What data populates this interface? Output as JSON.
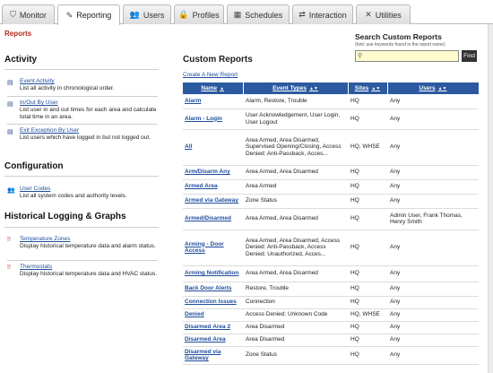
{
  "tabs": [
    {
      "label": "Monitor",
      "icon": "shield-icon"
    },
    {
      "label": "Reporting",
      "icon": "pencil-icon"
    },
    {
      "label": "Users",
      "icon": "users-icon"
    },
    {
      "label": "Profiles",
      "icon": "lock-icon"
    },
    {
      "label": "Schedules",
      "icon": "calendar-icon"
    },
    {
      "label": "Interaction",
      "icon": "arrows-icon"
    },
    {
      "label": "Utilities",
      "icon": "tools-icon"
    }
  ],
  "active_tab": "Reporting",
  "section_label": "Reports",
  "search": {
    "title": "Search Custom Reports",
    "hint": "(hint: use keywords found in the report name)",
    "value": "",
    "button": "Find"
  },
  "left": {
    "activity": {
      "heading": "Activity",
      "items": [
        {
          "link": "Event Activity",
          "desc": "List all activity in chronological order."
        },
        {
          "link": "In/Out By User",
          "desc": "List user in and out times for each area and calculate total time in an area."
        },
        {
          "link": "Exit Exception By User",
          "desc": "List users which have logged in but not logged out."
        }
      ]
    },
    "configuration": {
      "heading": "Configuration",
      "items": [
        {
          "link": "User Codes",
          "desc": "List all system codes and authority levels."
        }
      ]
    },
    "historical": {
      "heading": "Historical Logging & Graphs",
      "items": [
        {
          "link": "Temperature Zones",
          "desc": "Display historical temperature data and alarm status."
        },
        {
          "link": "Thermostats",
          "desc": "Display historical temperature data and HVAC status."
        }
      ]
    }
  },
  "custom_reports": {
    "title": "Custom Reports",
    "create_link": "Create A New Report",
    "columns": [
      "Name",
      "Event Types",
      "Sites",
      "Users"
    ],
    "rows": [
      {
        "name": "Alarm",
        "events": "Alarm, Restore, Trouble",
        "sites": "HQ",
        "users": "Any"
      },
      {
        "name": "Alarm - Login",
        "events": "User Acknowledgement, User Login, User Logout",
        "sites": "HQ",
        "users": "Any"
      },
      {
        "name": "All",
        "events": "Area Armed, Area Disarmed, Supervised Opening/Closing, Access Denied: Anti-Passback, Acces...",
        "sites": "HQ, WHSE",
        "users": "Any"
      },
      {
        "name": "Arm/Disarm Any",
        "events": "Area Armed, Area Disarmed",
        "sites": "HQ",
        "users": "Any"
      },
      {
        "name": "Armed Area",
        "events": "Area Armed",
        "sites": "HQ",
        "users": "Any"
      },
      {
        "name": "Armed via Gateway",
        "events": "Zone Status",
        "sites": "HQ",
        "users": "Any"
      },
      {
        "name": "Armed/Disarmed",
        "events": "Area Armed, Area Disarmed",
        "sites": "HQ",
        "users": "Admin User, Frank Thomas, Henry Smith"
      },
      {
        "name": "Arming - Door Access",
        "events": "Area Armed, Area Disarmed, Access Denied: Anti-Passback, Access Denied: Unauthorized, Acces...",
        "sites": "HQ",
        "users": "Any"
      },
      {
        "name": "Arming Notification",
        "events": "Area Armed, Area Disarmed",
        "sites": "HQ",
        "users": "Any"
      },
      {
        "name": "Back Door Alerts",
        "events": "Restore, Trouble",
        "sites": "HQ",
        "users": "Any"
      },
      {
        "name": "Connection Issues",
        "events": "Connection",
        "sites": "HQ",
        "users": "Any"
      },
      {
        "name": "Denied",
        "events": "Access Denied: Unknown Code",
        "sites": "HQ, WHSE",
        "users": "Any"
      },
      {
        "name": "Disarmed Area 2",
        "events": "Area Disarmed",
        "sites": "HQ",
        "users": "Any"
      },
      {
        "name": "Disarmed Area",
        "events": "Area Disarmed",
        "sites": "HQ",
        "users": "Any"
      },
      {
        "name": "Disarmed via Gateway",
        "events": "Zone Status",
        "sites": "HQ",
        "users": "Any"
      }
    ]
  }
}
